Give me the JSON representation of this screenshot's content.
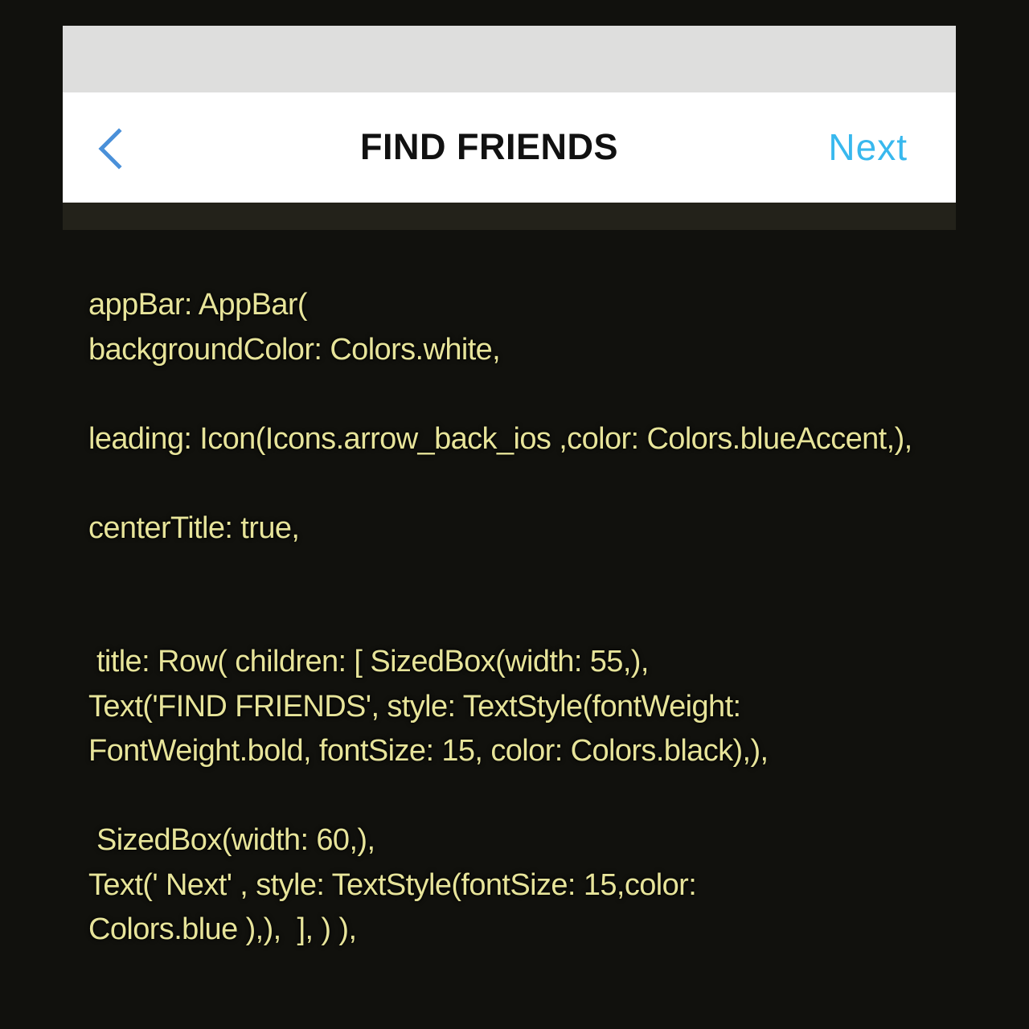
{
  "appbar": {
    "title": "FIND FRIENDS",
    "next_label": "Next",
    "back_icon": "chevron-left-icon",
    "colors": {
      "status_strip": "#dededd",
      "background": "#ffffff",
      "title": "#111111",
      "accent": "#38b8ee"
    }
  },
  "code": {
    "color": "#e7e49a",
    "lines": [
      "appBar: AppBar(",
      "backgroundColor: Colors.white,",
      "",
      "leading: Icon(Icons.arrow_back_ios ,color: Colors.blueAccent,),",
      "",
      "centerTitle: true,",
      "",
      "",
      " title: Row( children: [ SizedBox(width: 55,),",
      "Text('FIND FRIENDS', style: TextStyle(fontWeight:",
      "FontWeight.bold, fontSize: 15, color: Colors.black),),",
      "",
      " SizedBox(width: 60,),",
      "Text(' Next' , style: TextStyle(fontSize: 15,color:",
      "Colors.blue ),),  ], ) ),"
    ]
  }
}
